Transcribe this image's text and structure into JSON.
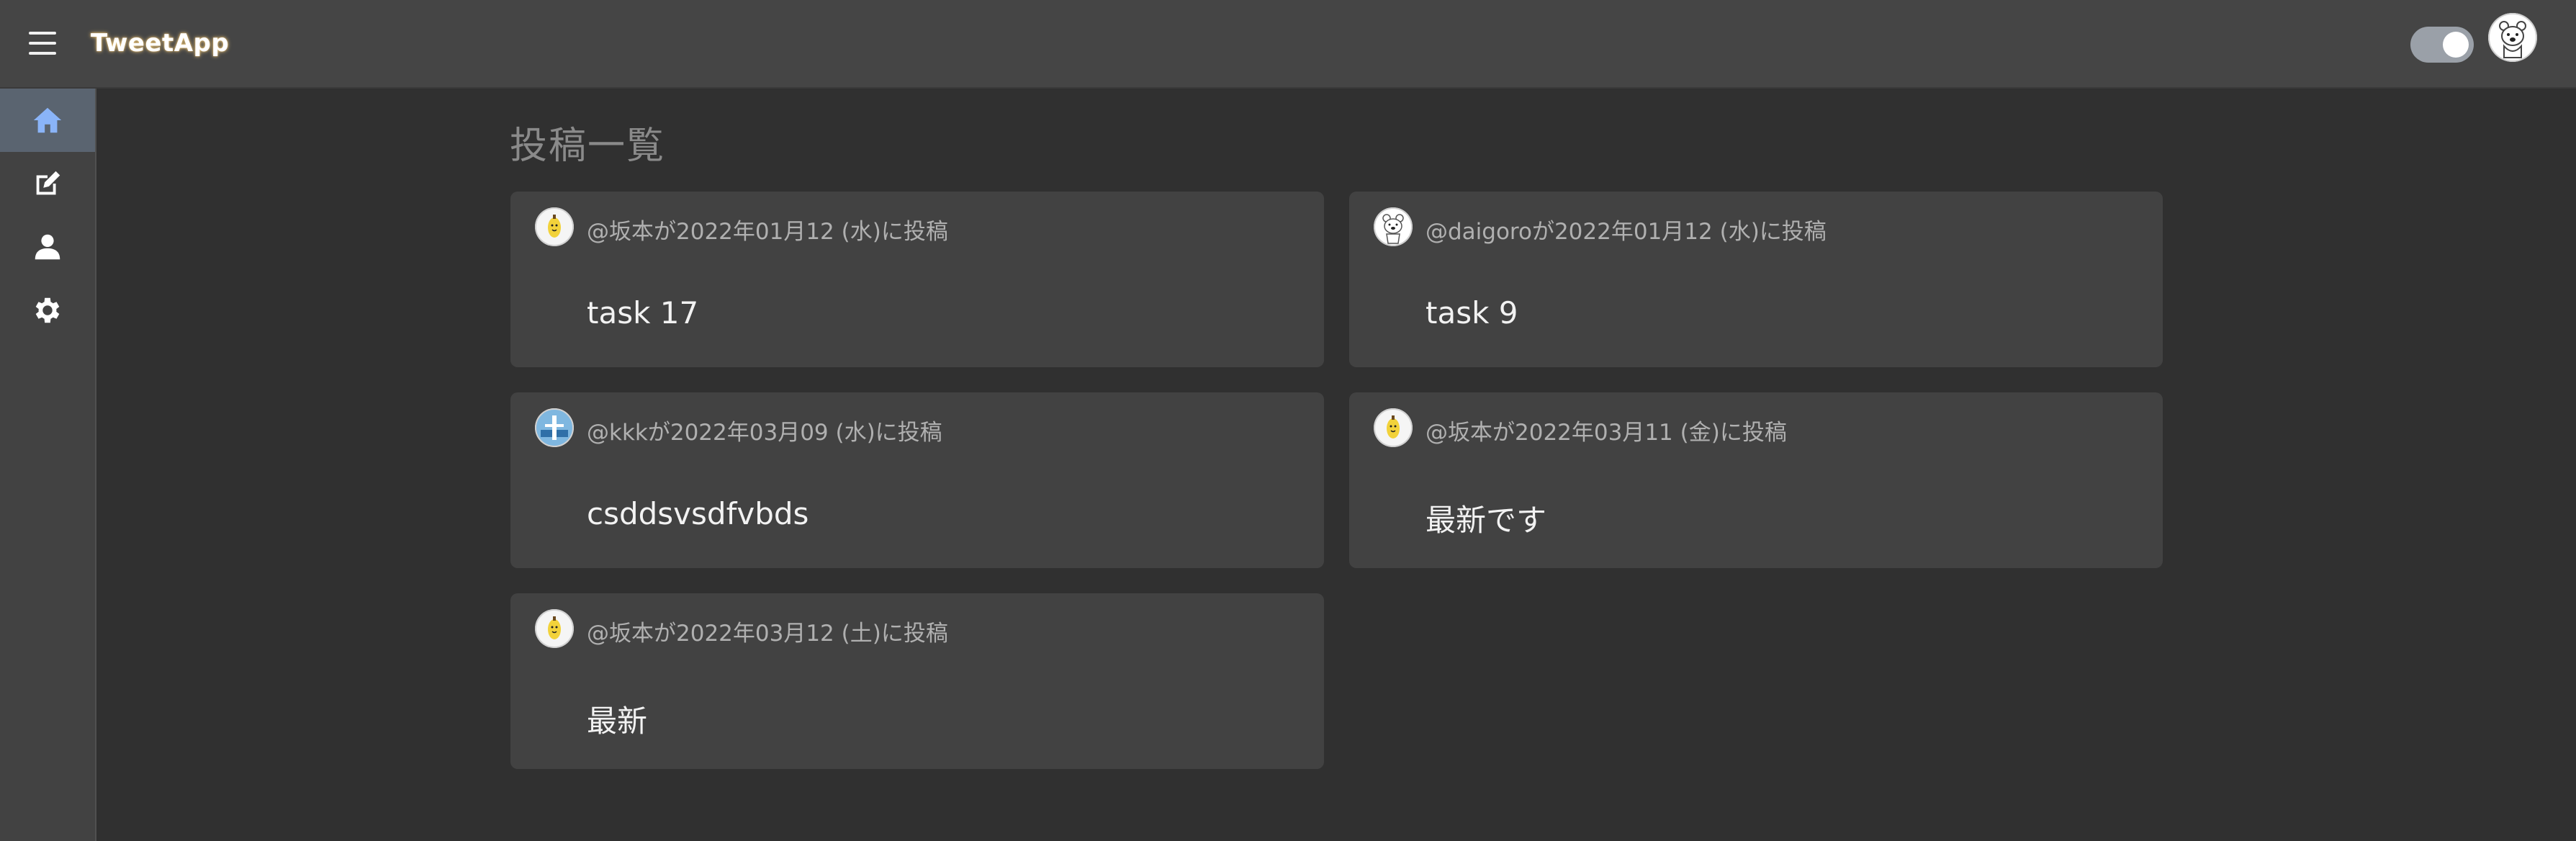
{
  "app": {
    "title": "TweetApp"
  },
  "header": {
    "theme_toggle_on": true
  },
  "sidebar": {
    "items": [
      {
        "name": "home",
        "icon": "home-icon",
        "active": true
      },
      {
        "name": "compose",
        "icon": "edit-icon",
        "active": false
      },
      {
        "name": "profile",
        "icon": "person-icon",
        "active": false
      },
      {
        "name": "settings",
        "icon": "gear-icon",
        "active": false
      }
    ]
  },
  "main": {
    "title": "投稿一覧",
    "posts": [
      {
        "meta": "@坂本が2022年01月12 (水)に投稿",
        "body": "task 17",
        "avatar": "banana-avatar"
      },
      {
        "meta": "@daigoroが2022年01月12 (水)に投稿",
        "body": "task 9",
        "avatar": "bear-avatar"
      },
      {
        "meta": "@kkkが2022年03月09 (水)に投稿",
        "body": "csddsvsdfvbds",
        "avatar": "blue-avatar"
      },
      {
        "meta": "@坂本が2022年03月11 (金)に投稿",
        "body": "最新です",
        "avatar": "banana-avatar"
      },
      {
        "meta": "@坂本が2022年03月12 (土)に投稿",
        "body": "最新",
        "avatar": "banana-avatar"
      }
    ]
  }
}
